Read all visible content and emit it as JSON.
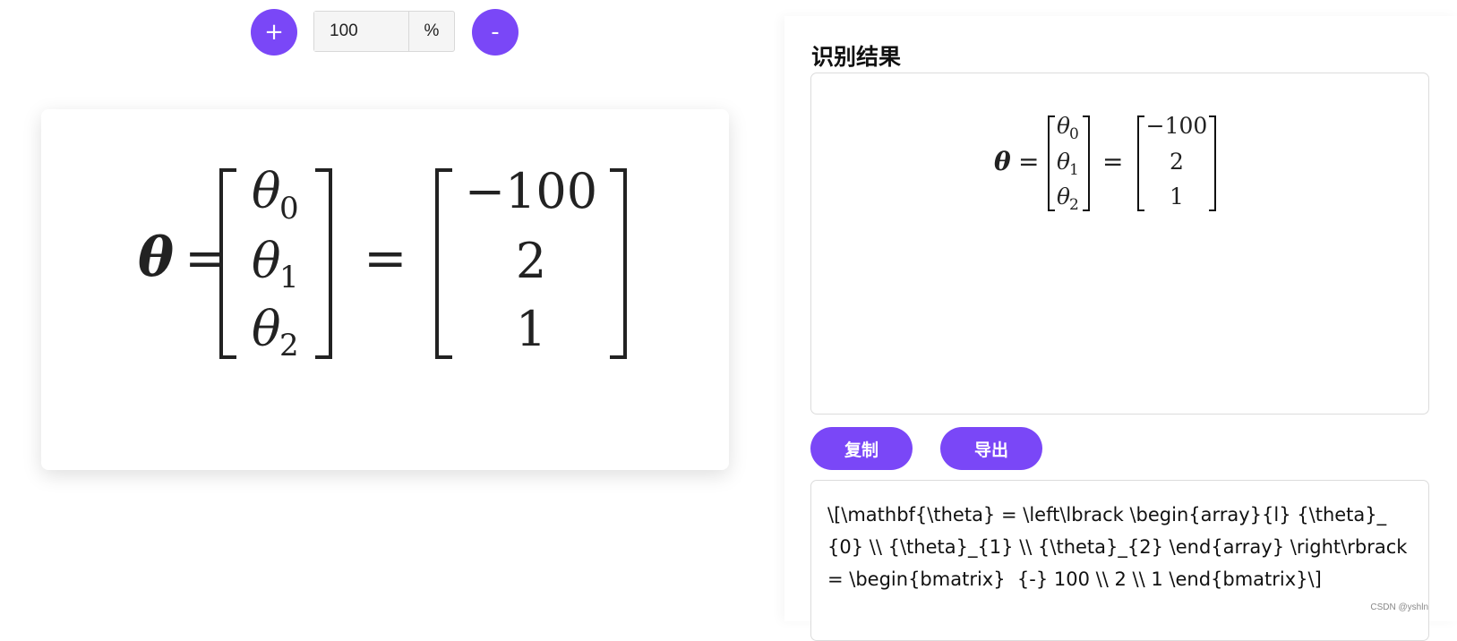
{
  "zoom": {
    "plus_label": "+",
    "minus_label": "-",
    "value": "100",
    "unit": "%"
  },
  "formula": {
    "lhs": "θ",
    "equals": "=",
    "vector": [
      {
        "symbol": "θ",
        "sub": "0"
      },
      {
        "symbol": "θ",
        "sub": "1"
      },
      {
        "symbol": "θ",
        "sub": "2"
      }
    ],
    "values": [
      "−100",
      "2",
      "1"
    ]
  },
  "result": {
    "title": "识别结果",
    "copy_label": "复制",
    "export_label": "导出",
    "latex": "\\[\\mathbf{\\theta} = \\left\\lbrack \\begin{array}{l} {\\theta}_{0} \\\\ {\\theta}_{1} \\\\ {\\theta}_{2} \\end{array} \\right\\rbrack = \\begin{bmatrix}  {-} 100 \\\\ 2 \\\\ 1 \\end{bmatrix}\\]"
  },
  "watermark": "CSDN @yshln"
}
